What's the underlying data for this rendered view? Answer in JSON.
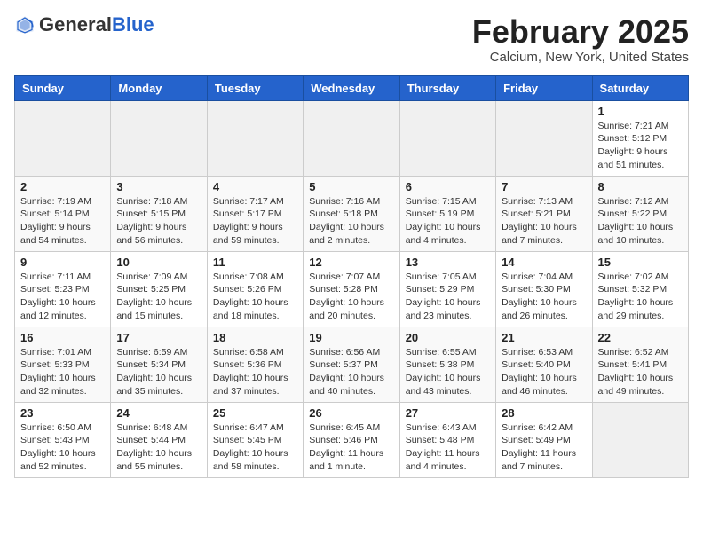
{
  "logo": {
    "general": "General",
    "blue": "Blue"
  },
  "header": {
    "month_title": "February 2025",
    "location": "Calcium, New York, United States"
  },
  "weekdays": [
    "Sunday",
    "Monday",
    "Tuesday",
    "Wednesday",
    "Thursday",
    "Friday",
    "Saturday"
  ],
  "weeks": [
    [
      {
        "day": "",
        "info": ""
      },
      {
        "day": "",
        "info": ""
      },
      {
        "day": "",
        "info": ""
      },
      {
        "day": "",
        "info": ""
      },
      {
        "day": "",
        "info": ""
      },
      {
        "day": "",
        "info": ""
      },
      {
        "day": "1",
        "info": "Sunrise: 7:21 AM\nSunset: 5:12 PM\nDaylight: 9 hours and 51 minutes."
      }
    ],
    [
      {
        "day": "2",
        "info": "Sunrise: 7:19 AM\nSunset: 5:14 PM\nDaylight: 9 hours and 54 minutes."
      },
      {
        "day": "3",
        "info": "Sunrise: 7:18 AM\nSunset: 5:15 PM\nDaylight: 9 hours and 56 minutes."
      },
      {
        "day": "4",
        "info": "Sunrise: 7:17 AM\nSunset: 5:17 PM\nDaylight: 9 hours and 59 minutes."
      },
      {
        "day": "5",
        "info": "Sunrise: 7:16 AM\nSunset: 5:18 PM\nDaylight: 10 hours and 2 minutes."
      },
      {
        "day": "6",
        "info": "Sunrise: 7:15 AM\nSunset: 5:19 PM\nDaylight: 10 hours and 4 minutes."
      },
      {
        "day": "7",
        "info": "Sunrise: 7:13 AM\nSunset: 5:21 PM\nDaylight: 10 hours and 7 minutes."
      },
      {
        "day": "8",
        "info": "Sunrise: 7:12 AM\nSunset: 5:22 PM\nDaylight: 10 hours and 10 minutes."
      }
    ],
    [
      {
        "day": "9",
        "info": "Sunrise: 7:11 AM\nSunset: 5:23 PM\nDaylight: 10 hours and 12 minutes."
      },
      {
        "day": "10",
        "info": "Sunrise: 7:09 AM\nSunset: 5:25 PM\nDaylight: 10 hours and 15 minutes."
      },
      {
        "day": "11",
        "info": "Sunrise: 7:08 AM\nSunset: 5:26 PM\nDaylight: 10 hours and 18 minutes."
      },
      {
        "day": "12",
        "info": "Sunrise: 7:07 AM\nSunset: 5:28 PM\nDaylight: 10 hours and 20 minutes."
      },
      {
        "day": "13",
        "info": "Sunrise: 7:05 AM\nSunset: 5:29 PM\nDaylight: 10 hours and 23 minutes."
      },
      {
        "day": "14",
        "info": "Sunrise: 7:04 AM\nSunset: 5:30 PM\nDaylight: 10 hours and 26 minutes."
      },
      {
        "day": "15",
        "info": "Sunrise: 7:02 AM\nSunset: 5:32 PM\nDaylight: 10 hours and 29 minutes."
      }
    ],
    [
      {
        "day": "16",
        "info": "Sunrise: 7:01 AM\nSunset: 5:33 PM\nDaylight: 10 hours and 32 minutes."
      },
      {
        "day": "17",
        "info": "Sunrise: 6:59 AM\nSunset: 5:34 PM\nDaylight: 10 hours and 35 minutes."
      },
      {
        "day": "18",
        "info": "Sunrise: 6:58 AM\nSunset: 5:36 PM\nDaylight: 10 hours and 37 minutes."
      },
      {
        "day": "19",
        "info": "Sunrise: 6:56 AM\nSunset: 5:37 PM\nDaylight: 10 hours and 40 minutes."
      },
      {
        "day": "20",
        "info": "Sunrise: 6:55 AM\nSunset: 5:38 PM\nDaylight: 10 hours and 43 minutes."
      },
      {
        "day": "21",
        "info": "Sunrise: 6:53 AM\nSunset: 5:40 PM\nDaylight: 10 hours and 46 minutes."
      },
      {
        "day": "22",
        "info": "Sunrise: 6:52 AM\nSunset: 5:41 PM\nDaylight: 10 hours and 49 minutes."
      }
    ],
    [
      {
        "day": "23",
        "info": "Sunrise: 6:50 AM\nSunset: 5:43 PM\nDaylight: 10 hours and 52 minutes."
      },
      {
        "day": "24",
        "info": "Sunrise: 6:48 AM\nSunset: 5:44 PM\nDaylight: 10 hours and 55 minutes."
      },
      {
        "day": "25",
        "info": "Sunrise: 6:47 AM\nSunset: 5:45 PM\nDaylight: 10 hours and 58 minutes."
      },
      {
        "day": "26",
        "info": "Sunrise: 6:45 AM\nSunset: 5:46 PM\nDaylight: 11 hours and 1 minute."
      },
      {
        "day": "27",
        "info": "Sunrise: 6:43 AM\nSunset: 5:48 PM\nDaylight: 11 hours and 4 minutes."
      },
      {
        "day": "28",
        "info": "Sunrise: 6:42 AM\nSunset: 5:49 PM\nDaylight: 11 hours and 7 minutes."
      },
      {
        "day": "",
        "info": ""
      }
    ]
  ]
}
